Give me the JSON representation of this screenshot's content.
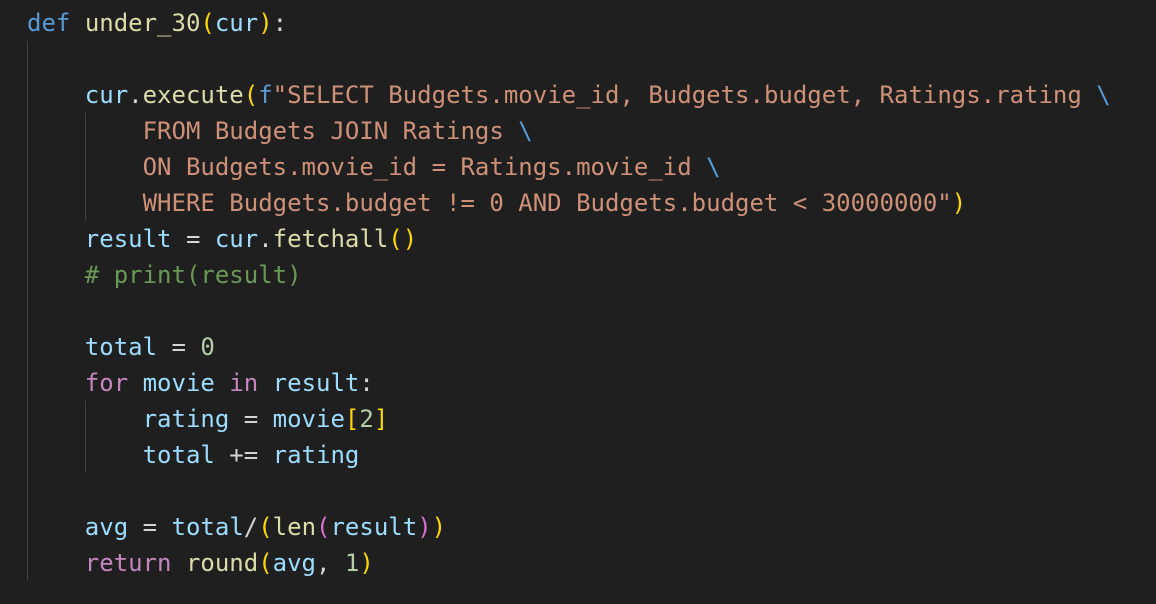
{
  "editor": {
    "language": "python",
    "theme_colors": {
      "background": "#1f1f1f",
      "keyword": "#569cd6",
      "control": "#c586c0",
      "function": "#dcdcaa",
      "variable": "#9cdcfe",
      "string": "#ce9178",
      "number": "#b5cea8",
      "comment": "#6a9955"
    },
    "lines": [
      [
        [
          "kw-blue",
          "def"
        ],
        [
          "op",
          " "
        ],
        [
          "fn",
          "under_30"
        ],
        [
          "br1",
          "("
        ],
        [
          "var",
          "cur"
        ],
        [
          "br1",
          ")"
        ],
        [
          "op",
          ":"
        ]
      ],
      [],
      [
        [
          "op",
          "    "
        ],
        [
          "var",
          "cur"
        ],
        [
          "op",
          "."
        ],
        [
          "fn",
          "execute"
        ],
        [
          "br1",
          "("
        ],
        [
          "kw-blue",
          "f"
        ],
        [
          "str",
          "\"SELECT Budgets.movie_id, Budgets.budget, Ratings.rating "
        ],
        [
          "esc",
          "\\"
        ]
      ],
      [
        [
          "str",
          "        FROM Budgets JOIN Ratings "
        ],
        [
          "esc",
          "\\"
        ]
      ],
      [
        [
          "str",
          "        ON Budgets.movie_id = Ratings.movie_id "
        ],
        [
          "esc",
          "\\"
        ]
      ],
      [
        [
          "str",
          "        WHERE Budgets.budget != 0 AND Budgets.budget < 30000000\""
        ],
        [
          "br1",
          ")"
        ]
      ],
      [
        [
          "op",
          "    "
        ],
        [
          "var",
          "result"
        ],
        [
          "op",
          " = "
        ],
        [
          "var",
          "cur"
        ],
        [
          "op",
          "."
        ],
        [
          "fn",
          "fetchall"
        ],
        [
          "br1",
          "()"
        ]
      ],
      [
        [
          "op",
          "    "
        ],
        [
          "cmt",
          "# print(result)"
        ]
      ],
      [],
      [
        [
          "op",
          "    "
        ],
        [
          "var",
          "total"
        ],
        [
          "op",
          " = "
        ],
        [
          "num",
          "0"
        ]
      ],
      [
        [
          "op",
          "    "
        ],
        [
          "kw-ctrl",
          "for"
        ],
        [
          "op",
          " "
        ],
        [
          "var",
          "movie"
        ],
        [
          "op",
          " "
        ],
        [
          "kw-ctrl",
          "in"
        ],
        [
          "op",
          " "
        ],
        [
          "var",
          "result"
        ],
        [
          "op",
          ":"
        ]
      ],
      [
        [
          "op",
          "        "
        ],
        [
          "var",
          "rating"
        ],
        [
          "op",
          " = "
        ],
        [
          "var",
          "movie"
        ],
        [
          "br1",
          "["
        ],
        [
          "num",
          "2"
        ],
        [
          "br1",
          "]"
        ]
      ],
      [
        [
          "op",
          "        "
        ],
        [
          "var",
          "total"
        ],
        [
          "op",
          " += "
        ],
        [
          "var",
          "rating"
        ]
      ],
      [],
      [
        [
          "op",
          "    "
        ],
        [
          "var",
          "avg"
        ],
        [
          "op",
          " = "
        ],
        [
          "var",
          "total"
        ],
        [
          "op",
          "/"
        ],
        [
          "br1",
          "("
        ],
        [
          "fn",
          "len"
        ],
        [
          "br2",
          "("
        ],
        [
          "var",
          "result"
        ],
        [
          "br2",
          ")"
        ],
        [
          "br1",
          ")"
        ]
      ],
      [
        [
          "op",
          "    "
        ],
        [
          "kw-ctrl",
          "return"
        ],
        [
          "op",
          " "
        ],
        [
          "fn",
          "round"
        ],
        [
          "br1",
          "("
        ],
        [
          "var",
          "avg"
        ],
        [
          "op",
          ", "
        ],
        [
          "num",
          "1"
        ],
        [
          "br1",
          ")"
        ]
      ]
    ]
  }
}
